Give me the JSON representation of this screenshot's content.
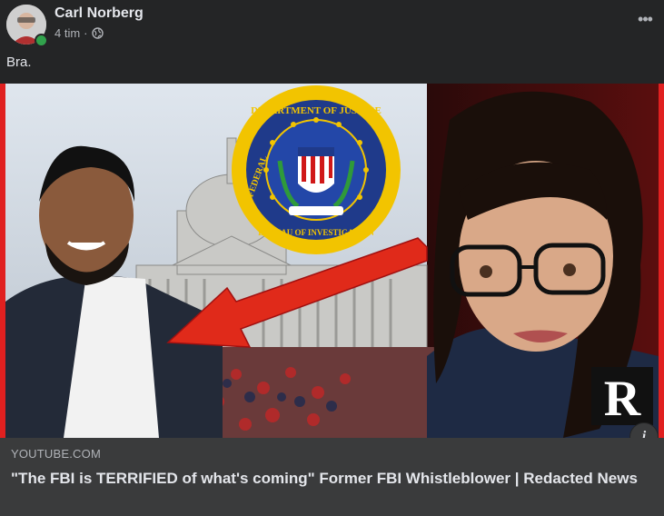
{
  "post": {
    "author": "Carl Norberg",
    "time": "4 tim",
    "separator": "·",
    "privacy_icon": "globe-icon",
    "more_icon": "more-options-icon",
    "more_label": "•••",
    "text": "Bra."
  },
  "link_preview": {
    "domain": "YOUTUBE.COM",
    "title": "\"The FBI is TERRIFIED of what's coming\" Former FBI Whistleblower | Redacted News",
    "thumbnail": {
      "seal_top_text": "DEPARTMENT OF JUSTICE",
      "seal_left_text": "FEDERAL",
      "seal_mid_text": "BUREAU OF INVESTIGATION",
      "channel_logo": "R",
      "accent_color": "#e02020"
    },
    "info_label": "i"
  },
  "colors": {
    "background": "#242526",
    "link_box": "#3a3b3c",
    "online": "#31a24c"
  }
}
